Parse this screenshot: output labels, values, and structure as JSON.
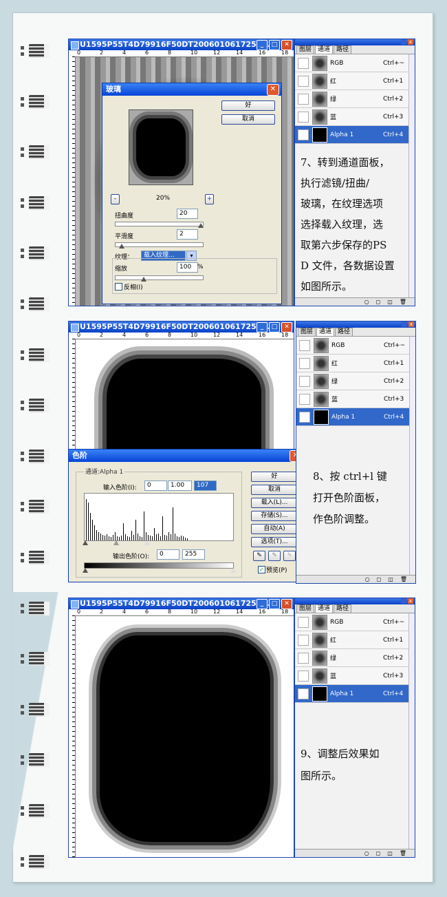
{
  "binder_rings": 17,
  "colors": {
    "accent": "#0a42c8",
    "selected_row": "#3168c9",
    "background": "#c9dbe0"
  },
  "doc_title": "U1595P55T4D79916F50DT2006010617250...",
  "ruler_ticks": [
    "0",
    "2",
    "4",
    "6",
    "8",
    "10",
    "12",
    "14",
    "16",
    "18"
  ],
  "panel": {
    "tabs": [
      "图层",
      "通道",
      "路径"
    ],
    "active_tab": "通道",
    "channels": [
      {
        "name": "RGB",
        "key": "Ctrl+~"
      },
      {
        "name": "红",
        "key": "Ctrl+1"
      },
      {
        "name": "绿",
        "key": "Ctrl+2"
      },
      {
        "name": "蓝",
        "key": "Ctrl+3"
      },
      {
        "name": "Alpha 1",
        "key": "Ctrl+4",
        "selected": true
      }
    ]
  },
  "step7": {
    "note": "7、转到通道面板，执行滤镜/扭曲/玻璃，在纹理选项选择载入纹理，选取第六步保存的PSD文件，各数据设置如图所示。",
    "note_lines": [
      "7、转到通道面板，",
      "执行滤镜/扭曲/",
      "玻璃，在纹理选项",
      "选择载入纹理，选",
      "取第六步保存的PS",
      "D 文件，各数据设置",
      "如图所示。"
    ],
    "dialog": {
      "title": "玻璃",
      "ok": "好",
      "cancel": "取消",
      "zoom": "20%",
      "minus": "-",
      "plus": "+",
      "distortion_label": "扭曲度",
      "distortion_value": "20",
      "smoothness_label": "平滑度",
      "smoothness_value": "2",
      "texture_label": "纹理：",
      "texture_value": "载入纹理...",
      "scale_label": "缩放",
      "scale_value": "100",
      "scale_unit": "%",
      "invert_label": "反相(I)"
    }
  },
  "step8": {
    "note_lines": [
      "8、按 ctrl+l 键",
      "打开色阶面板，",
      "作色阶调整。"
    ],
    "dialog": {
      "title": "色阶",
      "channel": "通道:Alpha 1",
      "input_label": "输入色阶(I):",
      "input_values": [
        "0",
        "1.00",
        "107"
      ],
      "output_label": "输出色阶(O):",
      "output_values": [
        "0",
        "255"
      ],
      "buttons": [
        "好",
        "取消",
        "载入(L)...",
        "存储(S)...",
        "自动(A)",
        "选项(T)..."
      ],
      "preview_label": "预览(P)"
    }
  },
  "step9": {
    "note_lines": [
      "9、调整后效果如",
      "图所示。"
    ]
  }
}
